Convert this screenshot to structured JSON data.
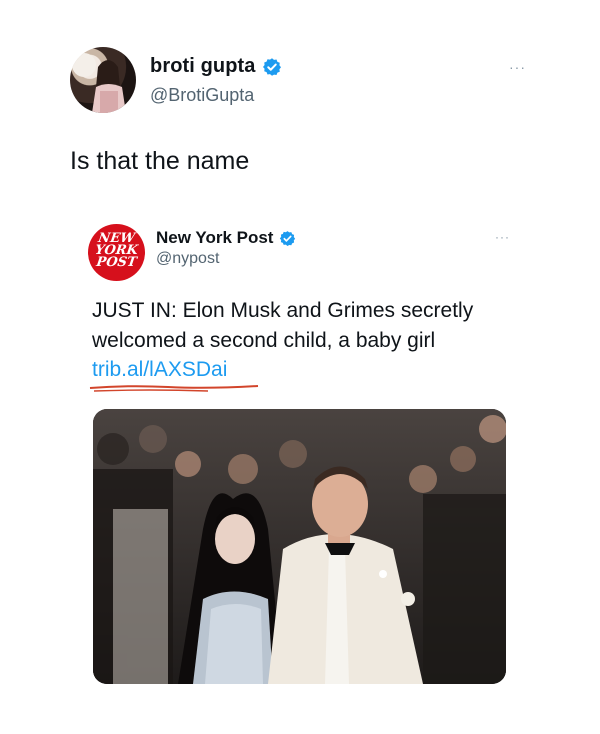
{
  "tweet": {
    "author": {
      "display_name": "broti gupta",
      "handle": "@BrotiGupta",
      "verified_icon": "verified-badge-icon"
    },
    "more_label": "···",
    "text": "Is that the name"
  },
  "quoted_tweet": {
    "author": {
      "display_name": "New York Post",
      "handle": "@nypost",
      "logo_lines": [
        "NEW",
        "YORK",
        "POST"
      ],
      "verified_icon": "verified-badge-icon"
    },
    "more_label": "···",
    "text": "JUST IN: Elon Musk and Grimes secretly welcomed a second child, a baby girl",
    "link": "trib.al/lAXSDai",
    "image_icon": "photo-icon"
  },
  "colors": {
    "link": "#1d9bf0",
    "verified": "#1d9bf0",
    "nypost_red": "#d6101c",
    "underline_annotation": "#d2452b"
  }
}
